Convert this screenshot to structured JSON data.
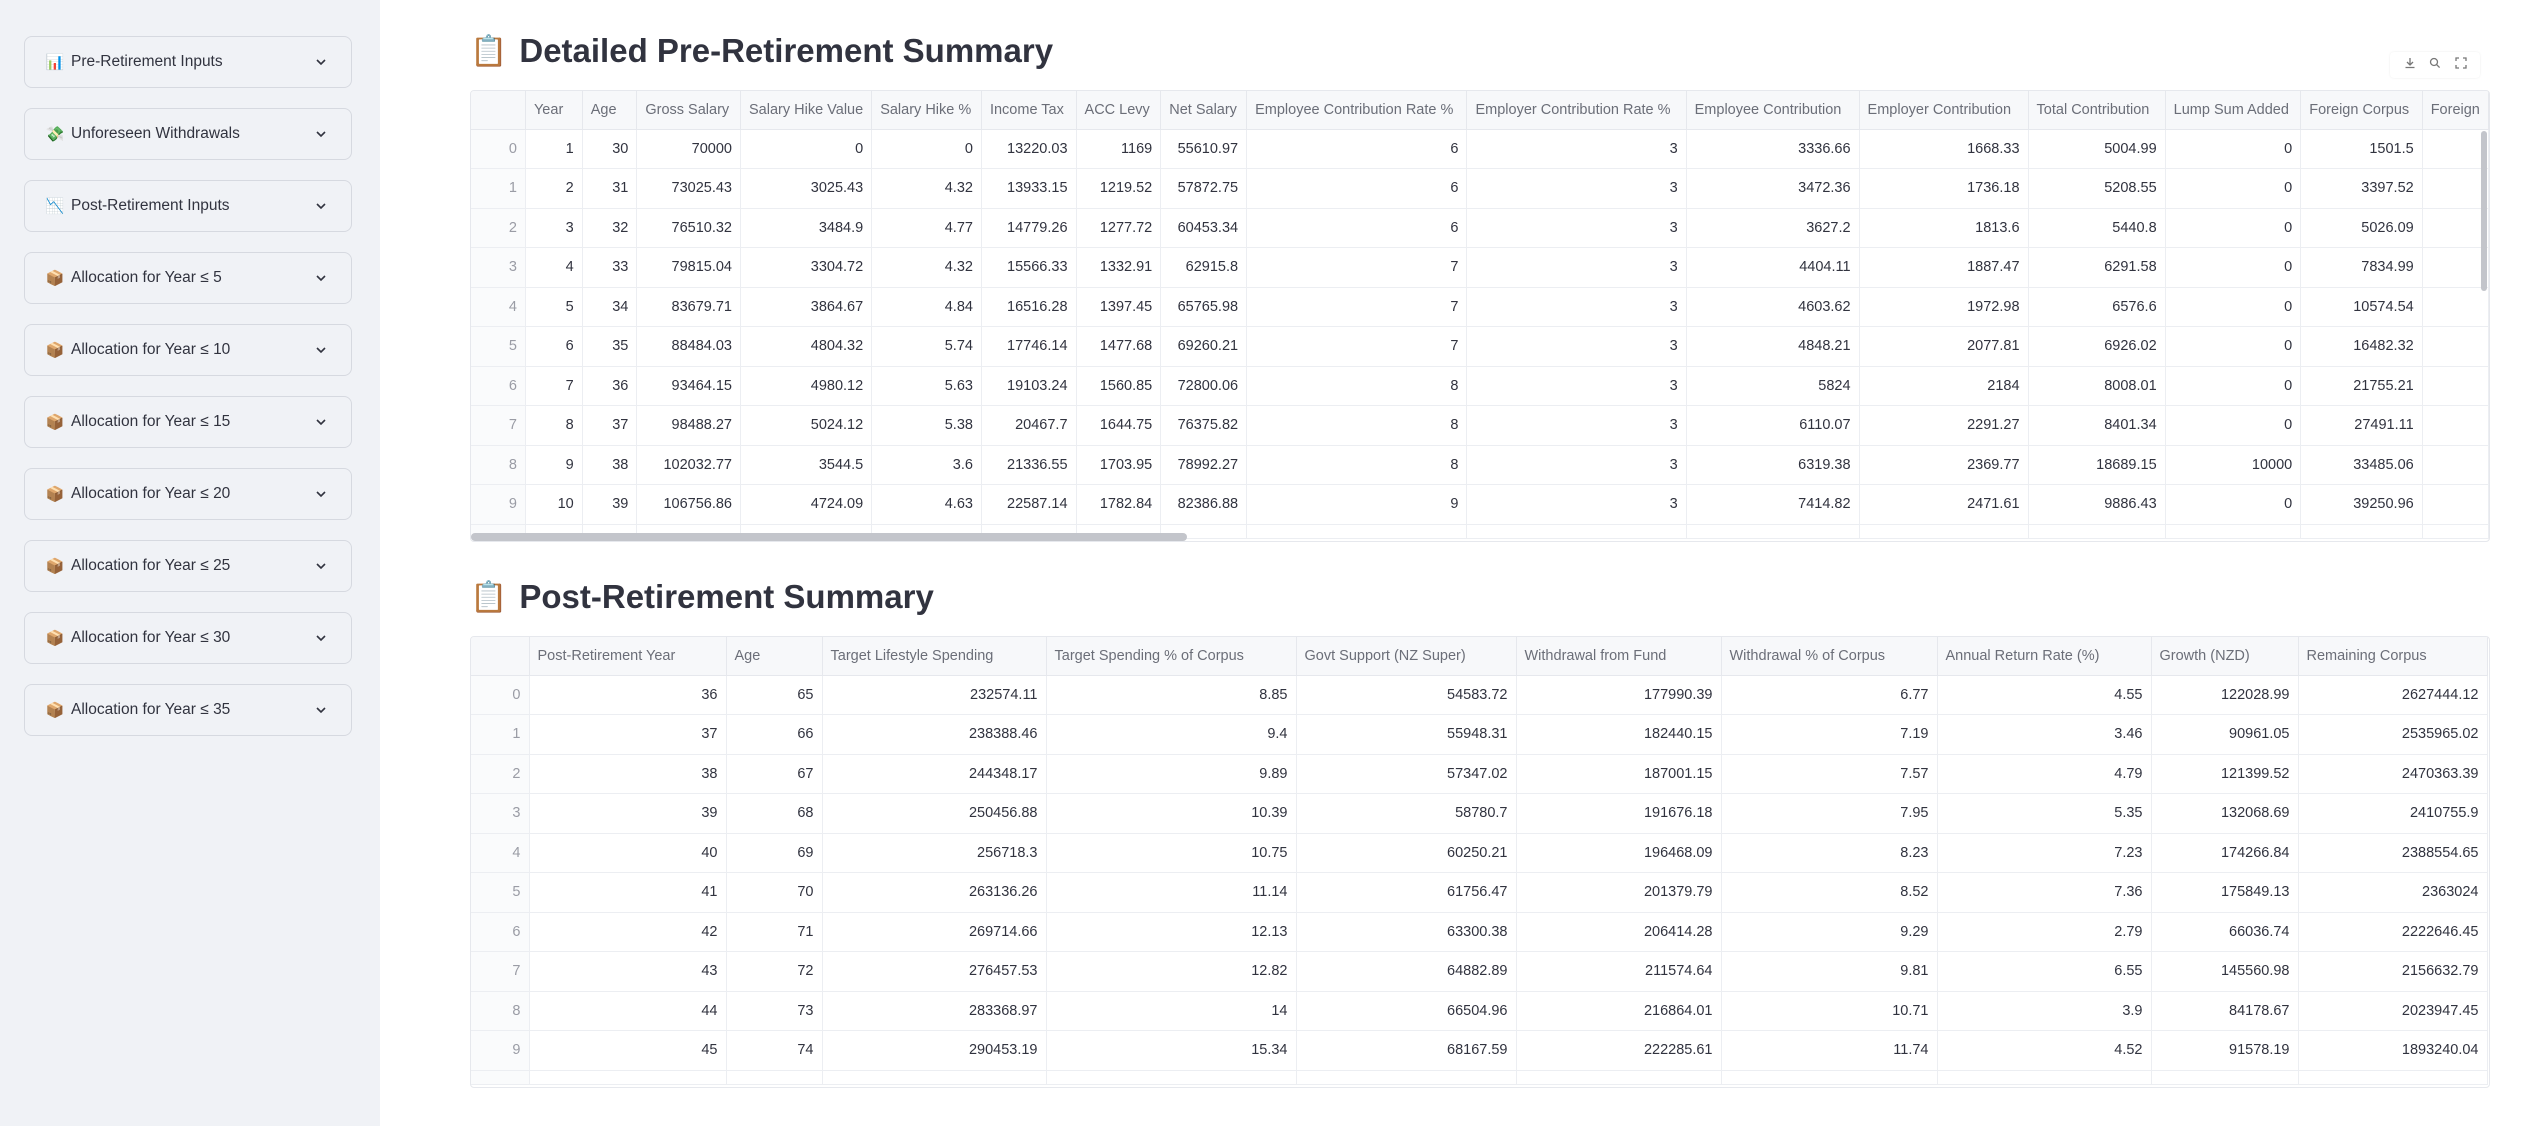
{
  "sidebar": {
    "items": [
      {
        "icon": "📊",
        "label": "Pre-Retirement Inputs"
      },
      {
        "icon": "💸",
        "label": "Unforeseen Withdrawals"
      },
      {
        "icon": "📉",
        "label": "Post-Retirement Inputs"
      },
      {
        "icon": "📦",
        "label": "Allocation for Year ≤ 5"
      },
      {
        "icon": "📦",
        "label": "Allocation for Year ≤ 10"
      },
      {
        "icon": "📦",
        "label": "Allocation for Year ≤ 15"
      },
      {
        "icon": "📦",
        "label": "Allocation for Year ≤ 20"
      },
      {
        "icon": "📦",
        "label": "Allocation for Year ≤ 25"
      },
      {
        "icon": "📦",
        "label": "Allocation for Year ≤ 30"
      },
      {
        "icon": "📦",
        "label": "Allocation for Year ≤ 35"
      }
    ]
  },
  "pre": {
    "title": "Detailed Pre-Retirement Summary",
    "title_icon": "📋",
    "columns": [
      "",
      "Year",
      "Age",
      "Gross Salary",
      "Salary Hike Value",
      "Salary Hike %",
      "Income Tax",
      "ACC Levy",
      "Net Salary",
      "Employee Contribution Rate %",
      "Employer Contribution Rate %",
      "Employee Contribution",
      "Employer Contribution",
      "Total Contribution",
      "Lump Sum Added",
      "Foreign Corpus",
      "Foreign"
    ],
    "rows": [
      [
        "0",
        "1",
        "30",
        "70000",
        "0",
        "0",
        "13220.03",
        "1169",
        "55610.97",
        "6",
        "3",
        "3336.66",
        "1668.33",
        "5004.99",
        "0",
        "1501.5",
        ""
      ],
      [
        "1",
        "2",
        "31",
        "73025.43",
        "3025.43",
        "4.32",
        "13933.15",
        "1219.52",
        "57872.75",
        "6",
        "3",
        "3472.36",
        "1736.18",
        "5208.55",
        "0",
        "3397.52",
        ""
      ],
      [
        "2",
        "3",
        "32",
        "76510.32",
        "3484.9",
        "4.77",
        "14779.26",
        "1277.72",
        "60453.34",
        "6",
        "3",
        "3627.2",
        "1813.6",
        "5440.8",
        "0",
        "5026.09",
        ""
      ],
      [
        "3",
        "4",
        "33",
        "79815.04",
        "3304.72",
        "4.32",
        "15566.33",
        "1332.91",
        "62915.8",
        "7",
        "3",
        "4404.11",
        "1887.47",
        "6291.58",
        "0",
        "7834.99",
        ""
      ],
      [
        "4",
        "5",
        "34",
        "83679.71",
        "3864.67",
        "4.84",
        "16516.28",
        "1397.45",
        "65765.98",
        "7",
        "3",
        "4603.62",
        "1972.98",
        "6576.6",
        "0",
        "10574.54",
        ""
      ],
      [
        "5",
        "6",
        "35",
        "88484.03",
        "4804.32",
        "5.74",
        "17746.14",
        "1477.68",
        "69260.21",
        "7",
        "3",
        "4848.21",
        "2077.81",
        "6926.02",
        "0",
        "16482.32",
        ""
      ],
      [
        "6",
        "7",
        "36",
        "93464.15",
        "4980.12",
        "5.63",
        "19103.24",
        "1560.85",
        "72800.06",
        "8",
        "3",
        "5824",
        "2184",
        "8008.01",
        "0",
        "21755.21",
        ""
      ],
      [
        "7",
        "8",
        "37",
        "98488.27",
        "5024.12",
        "5.38",
        "20467.7",
        "1644.75",
        "76375.82",
        "8",
        "3",
        "6110.07",
        "2291.27",
        "8401.34",
        "0",
        "27491.11",
        ""
      ],
      [
        "8",
        "9",
        "38",
        "102032.77",
        "3544.5",
        "3.6",
        "21336.55",
        "1703.95",
        "78992.27",
        "8",
        "3",
        "6319.38",
        "2369.77",
        "18689.15",
        "10000",
        "33485.06",
        ""
      ],
      [
        "9",
        "10",
        "39",
        "106756.86",
        "4724.09",
        "4.63",
        "22587.14",
        "1782.84",
        "82386.88",
        "9",
        "3",
        "7414.82",
        "2471.61",
        "9886.43",
        "0",
        "39250.96",
        ""
      ]
    ]
  },
  "post": {
    "title": "Post-Retirement Summary",
    "title_icon": "📋",
    "columns": [
      "",
      "Post-Retirement Year",
      "Age",
      "Target Lifestyle Spending",
      "Target Spending % of Corpus",
      "Govt Support (NZ Super)",
      "Withdrawal from Fund",
      "Withdrawal % of Corpus",
      "Annual Return Rate (%)",
      "Growth (NZD)",
      "Remaining Corpus"
    ],
    "rows": [
      [
        "0",
        "36",
        "65",
        "232574.11",
        "8.85",
        "54583.72",
        "177990.39",
        "6.77",
        "4.55",
        "122028.99",
        "2627444.12"
      ],
      [
        "1",
        "37",
        "66",
        "238388.46",
        "9.4",
        "55948.31",
        "182440.15",
        "7.19",
        "3.46",
        "90961.05",
        "2535965.02"
      ],
      [
        "2",
        "38",
        "67",
        "244348.17",
        "9.89",
        "57347.02",
        "187001.15",
        "7.57",
        "4.79",
        "121399.52",
        "2470363.39"
      ],
      [
        "3",
        "39",
        "68",
        "250456.88",
        "10.39",
        "58780.7",
        "191676.18",
        "7.95",
        "5.35",
        "132068.69",
        "2410755.9"
      ],
      [
        "4",
        "40",
        "69",
        "256718.3",
        "10.75",
        "60250.21",
        "196468.09",
        "8.23",
        "7.23",
        "174266.84",
        "2388554.65"
      ],
      [
        "5",
        "41",
        "70",
        "263136.26",
        "11.14",
        "61756.47",
        "201379.79",
        "8.52",
        "7.36",
        "175849.13",
        "2363024"
      ],
      [
        "6",
        "42",
        "71",
        "269714.66",
        "12.13",
        "63300.38",
        "206414.28",
        "9.29",
        "2.79",
        "66036.74",
        "2222646.45"
      ],
      [
        "7",
        "43",
        "72",
        "276457.53",
        "12.82",
        "64882.89",
        "211574.64",
        "9.81",
        "6.55",
        "145560.98",
        "2156632.79"
      ],
      [
        "8",
        "44",
        "73",
        "283368.97",
        "14",
        "66504.96",
        "216864.01",
        "10.71",
        "3.9",
        "84178.67",
        "2023947.45"
      ],
      [
        "9",
        "45",
        "74",
        "290453.19",
        "15.34",
        "68167.59",
        "222285.61",
        "11.74",
        "4.52",
        "91578.19",
        "1893240.04"
      ]
    ]
  },
  "toolbar": {
    "icons": [
      "download-icon",
      "search-icon",
      "fullscreen-icon"
    ]
  }
}
